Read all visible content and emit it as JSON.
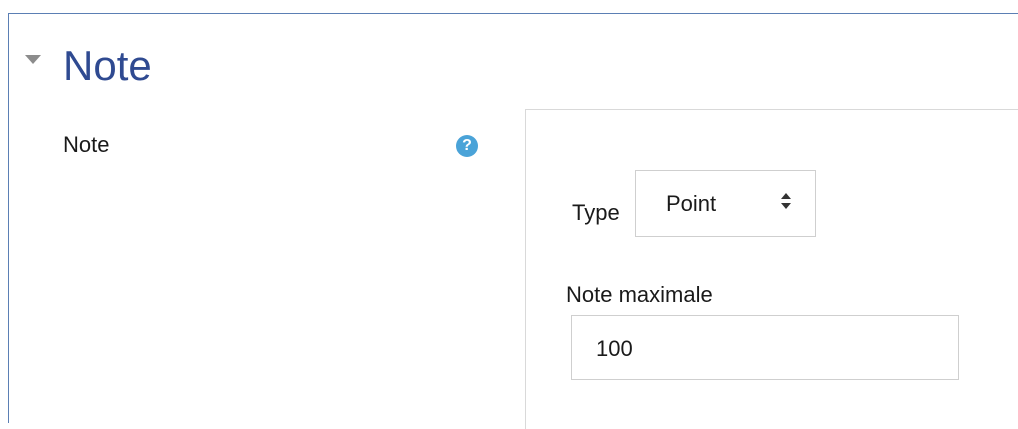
{
  "section": {
    "title": "Note",
    "toggle_icon": "caret-down-icon",
    "title_color": "#2f4a91"
  },
  "field": {
    "label": "Note",
    "help_icon": "question-circle-icon",
    "help_glyph": "?",
    "help_color": "#4aa3d8"
  },
  "grade": {
    "type_label": "Type",
    "type_value": "Point",
    "type_icon": "sort-arrows-icon",
    "max_label": "Note maximale",
    "max_value": "100"
  }
}
